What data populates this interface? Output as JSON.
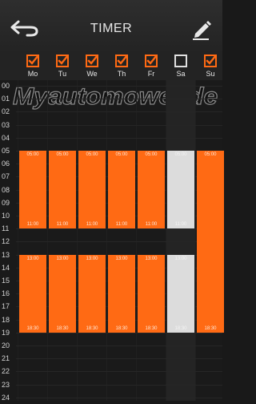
{
  "header": {
    "title": "TIMER",
    "back_icon": "back-arrow-icon",
    "edit_icon": "pencil-icon"
  },
  "days": [
    {
      "label": "Mo",
      "checked": true
    },
    {
      "label": "Tu",
      "checked": true
    },
    {
      "label": "We",
      "checked": true
    },
    {
      "label": "Th",
      "checked": true
    },
    {
      "label": "Fr",
      "checked": true
    },
    {
      "label": "Sa",
      "checked": false
    },
    {
      "label": "Su",
      "checked": true
    }
  ],
  "hours": [
    "00",
    "01",
    "02",
    "03",
    "04",
    "05",
    "06",
    "07",
    "08",
    "09",
    "10",
    "11",
    "12",
    "13",
    "14",
    "15",
    "16",
    "17",
    "18",
    "19",
    "20",
    "21",
    "22",
    "23",
    "24"
  ],
  "watermark": "Myautomower.de",
  "schedule": {
    "Mo": [
      {
        "start": "05:00",
        "end": "11:00"
      },
      {
        "start": "13:00",
        "end": "18:30"
      }
    ],
    "Tu": [
      {
        "start": "05:00",
        "end": "11:00"
      },
      {
        "start": "13:00",
        "end": "18:30"
      }
    ],
    "We": [
      {
        "start": "05:00",
        "end": "11:00"
      },
      {
        "start": "13:00",
        "end": "18:30"
      }
    ],
    "Th": [
      {
        "start": "05:00",
        "end": "11:00"
      },
      {
        "start": "13:00",
        "end": "18:30"
      }
    ],
    "Fr": [
      {
        "start": "05:00",
        "end": "11:00"
      },
      {
        "start": "13:00",
        "end": "18:30"
      }
    ],
    "Sa": [
      {
        "start": "05:00",
        "end": "11:00"
      },
      {
        "start": "13:00",
        "end": "18:30"
      }
    ],
    "Su": [
      {
        "start": "05:00",
        "end": "18:30"
      }
    ]
  },
  "colors": {
    "active": "#ff6a14",
    "inactive": "#dcdcdc",
    "checkbox": "#ff6a14",
    "checkbox_unchecked": "#e0e0e0"
  }
}
